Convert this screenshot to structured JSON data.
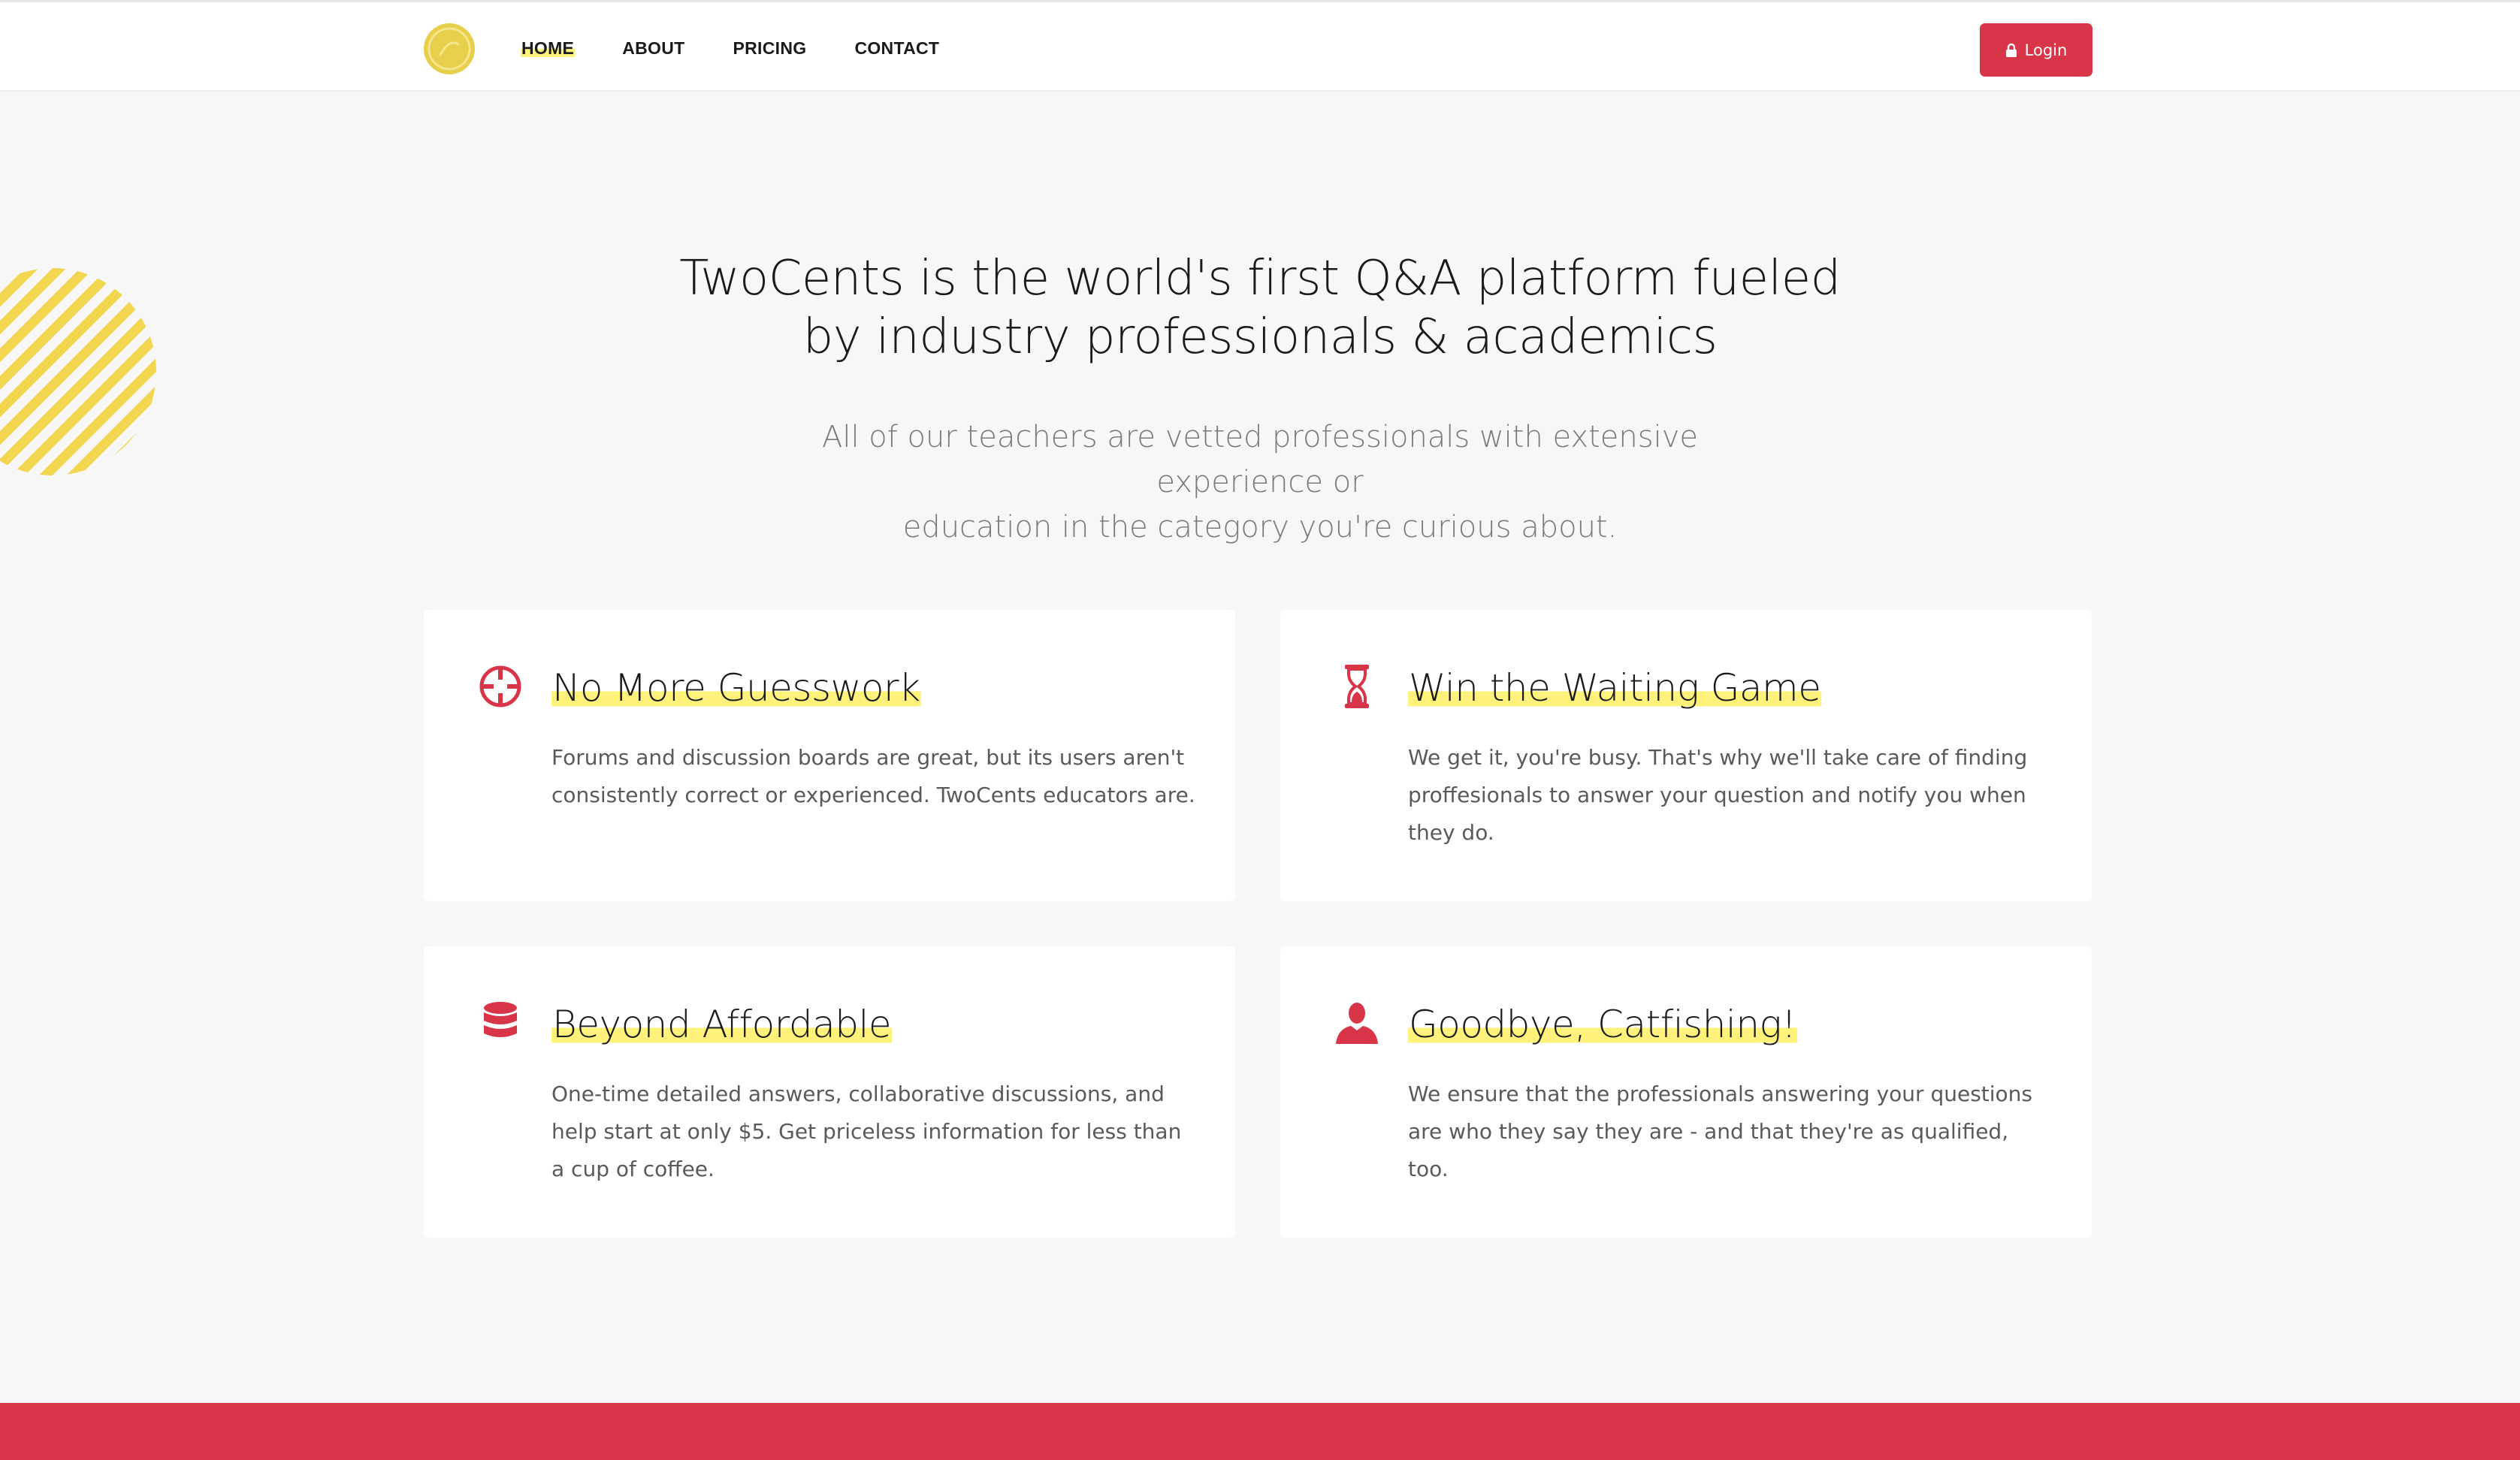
{
  "colors": {
    "accent": "#d93548",
    "highlight": "#fff27a",
    "logo_gold": "#e8cf4b",
    "background": "#f7f7f7"
  },
  "nav": {
    "logo_icon": "coin-icon",
    "links": [
      {
        "label": "HOME",
        "active": true
      },
      {
        "label": "ABOUT",
        "active": false
      },
      {
        "label": "PRICING",
        "active": false
      },
      {
        "label": "CONTACT",
        "active": false
      }
    ],
    "login_label": "Login",
    "login_icon": "lock-icon"
  },
  "hero": {
    "title_line1": "TwoCents is the world's first Q&A platform fueled",
    "title_line2": "by industry professionals & academics",
    "subtitle_line1": "All of our teachers are vetted professionals with extensive experience or",
    "subtitle_line2": "education in the category you're curious about."
  },
  "features": [
    {
      "icon": "crosshair-icon",
      "title": "No More Guesswork",
      "text": "Forums and discussion boards are great, but its users aren't consistently correct or experienced. TwoCents educators are."
    },
    {
      "icon": "hourglass-icon",
      "title": "Win the Waiting Game",
      "text": "We get it, you're busy. That's why we'll take care of finding proffesionals to answer your question and notify you when they do."
    },
    {
      "icon": "database-icon",
      "title": "Beyond Affordable",
      "text": "One-time detailed answers, collaborative discussions, and help start at only $5. Get priceless information for less than a cup of coffee."
    },
    {
      "icon": "user-icon",
      "title": "Goodbye, Catfishing!",
      "text": "We ensure that the professionals answering your questions are who they say they are - and that they're as qualified, too."
    }
  ]
}
